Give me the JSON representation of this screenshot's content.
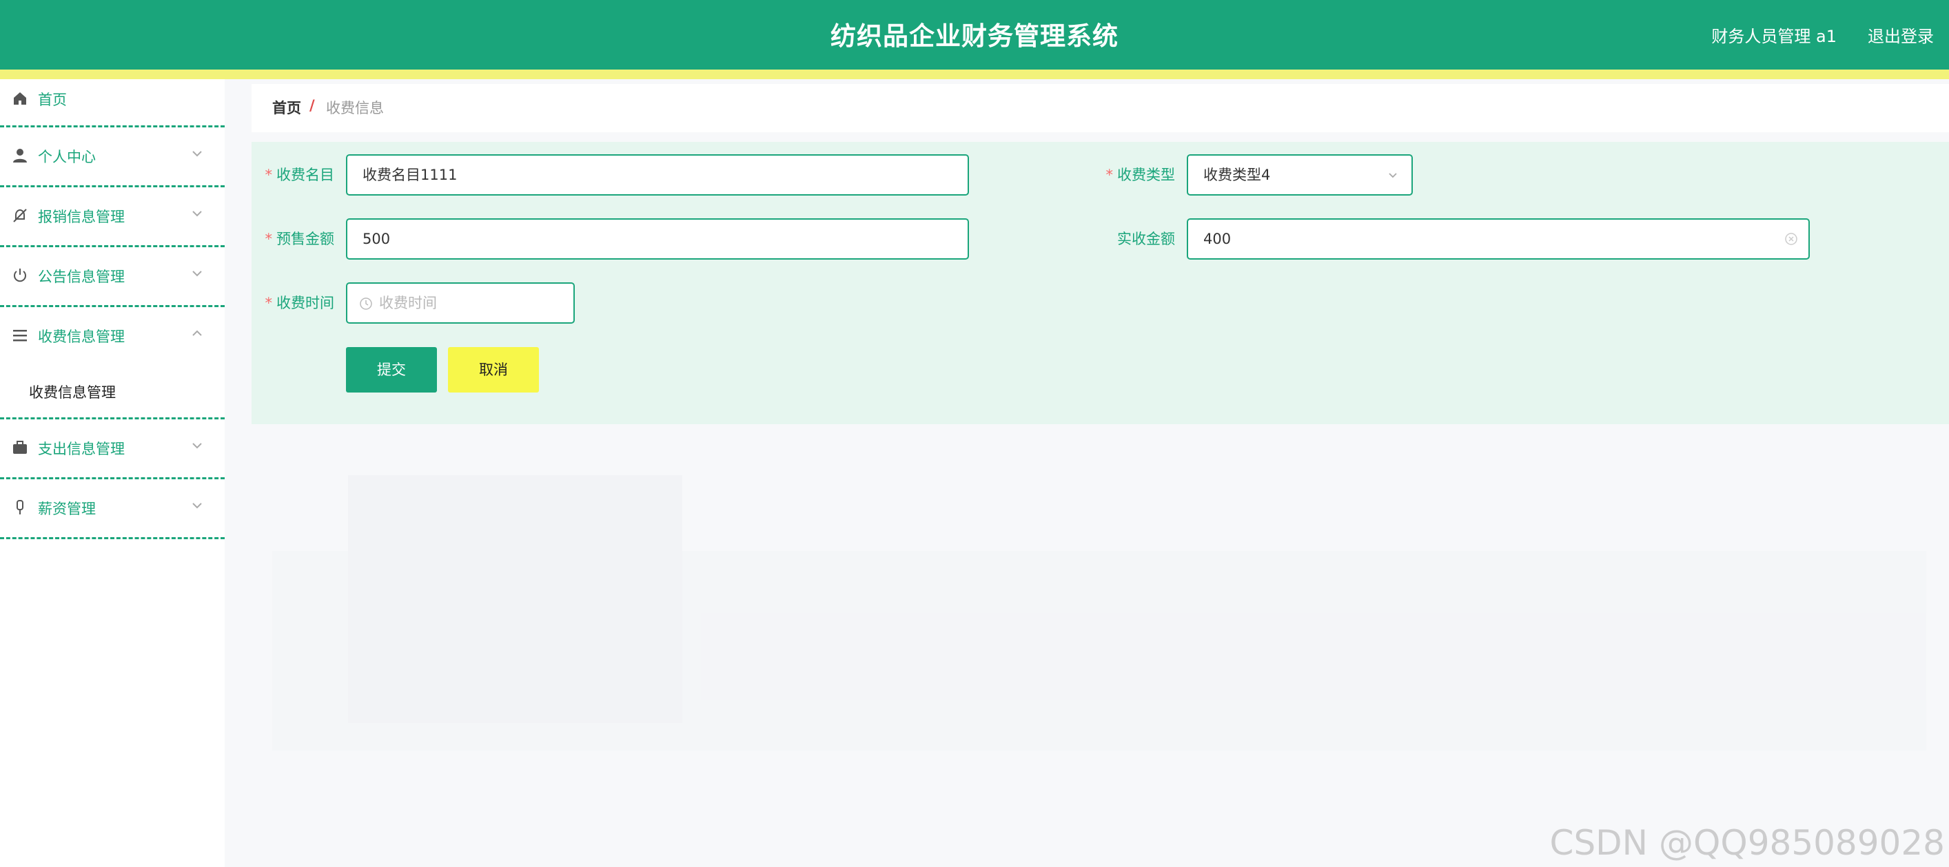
{
  "header": {
    "title": "纺织品企业财务管理系统",
    "user": "财务人员管理 a1",
    "logout": "退出登录"
  },
  "sidebar": {
    "items": [
      {
        "label": "首页",
        "icon": "home-icon"
      },
      {
        "label": "个人中心",
        "icon": "user-icon"
      },
      {
        "label": "报销信息管理",
        "icon": "bell-off-icon"
      },
      {
        "label": "公告信息管理",
        "icon": "power-icon"
      },
      {
        "label": "收费信息管理",
        "icon": "menu-icon",
        "expanded": true,
        "children": [
          {
            "label": "收费信息管理"
          }
        ]
      },
      {
        "label": "支出信息管理",
        "icon": "briefcase-icon"
      },
      {
        "label": "薪资管理",
        "icon": "mic-icon"
      }
    ]
  },
  "breadcrumb": {
    "home": "首页",
    "sep": "/",
    "current": "收费信息"
  },
  "form": {
    "name_label": "收费名目",
    "name_value": "收费名目1111",
    "type_label": "收费类型",
    "type_value": "收费类型4",
    "presale_label": "预售金额",
    "presale_value": "500",
    "actual_label": "实收金额",
    "actual_value": "400",
    "time_label": "收费时间",
    "time_placeholder": "收费时间",
    "required_mark": "*",
    "submit": "提交",
    "cancel": "取消"
  },
  "watermark": "CSDN @QQ985089028",
  "colors": {
    "primary": "#1aa57b",
    "stripe": "#f2f27a",
    "cancel": "#f7f74a",
    "required": "#f56c6c"
  }
}
